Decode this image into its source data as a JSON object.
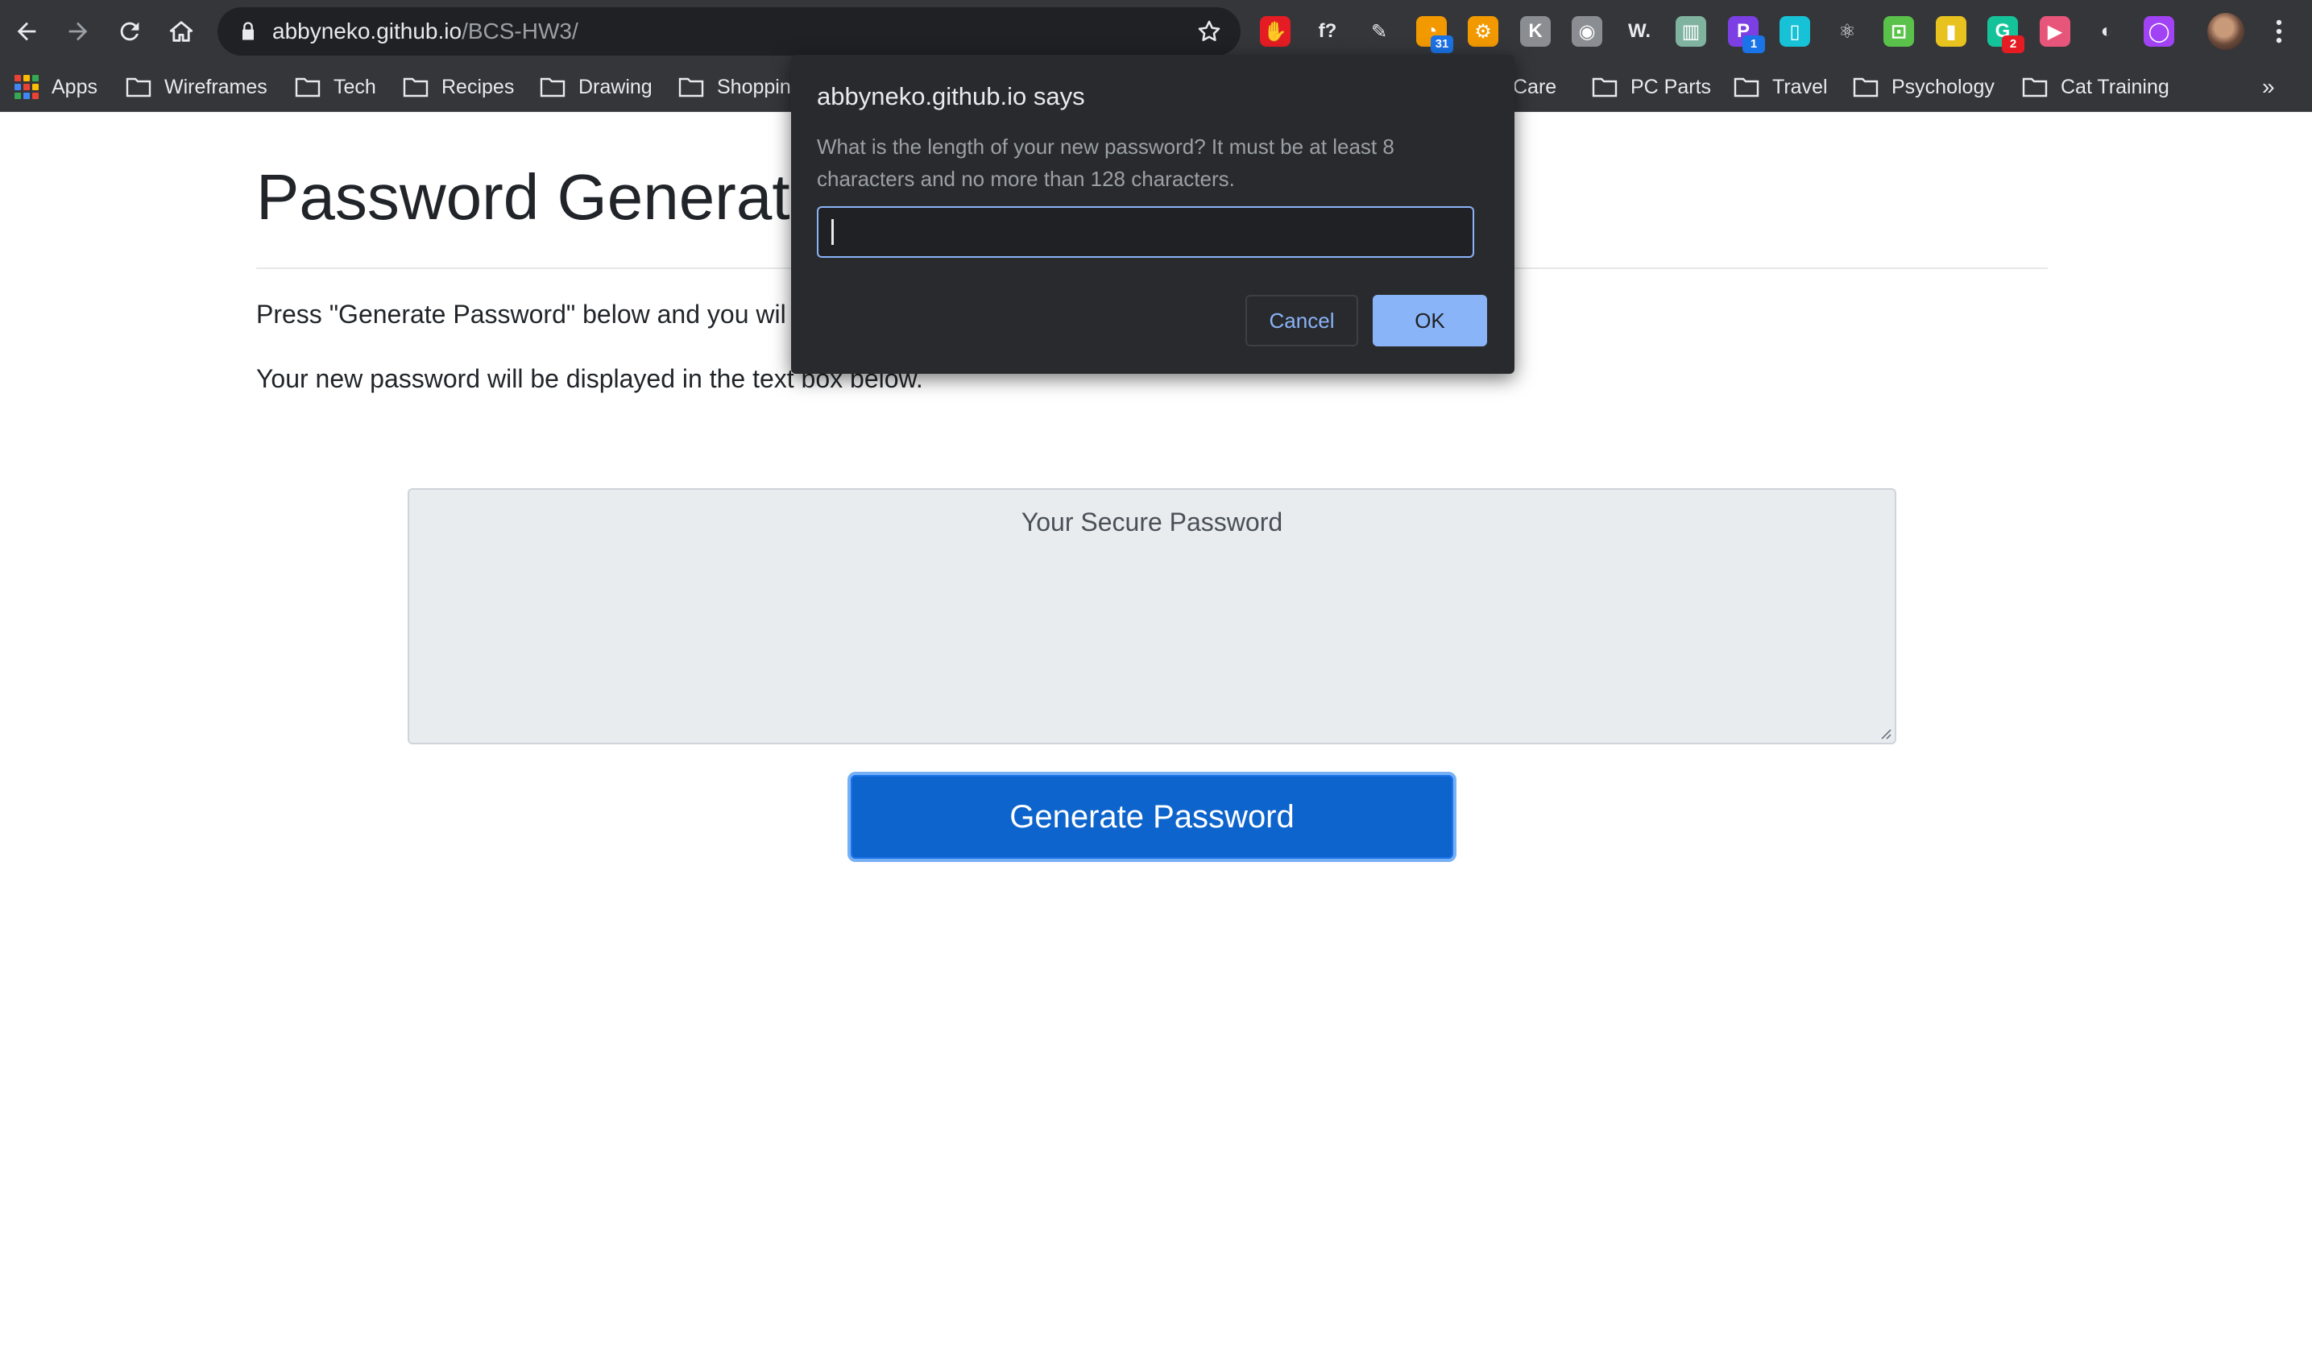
{
  "browser": {
    "url_host": "abbyneko.github.io",
    "url_path": "/BCS-HW3/",
    "extensions": [
      {
        "name": "adblock-icon",
        "color": "#e51c23",
        "glyph": "✋"
      },
      {
        "name": "font-finder-icon",
        "color": "#35363a",
        "glyph": "f?"
      },
      {
        "name": "pen-icon",
        "color": "#35363a",
        "glyph": "✎"
      },
      {
        "name": "rss-icon",
        "color": "#f29900",
        "glyph": "◔",
        "badge": "31",
        "badge_color": "#1a73e8"
      },
      {
        "name": "gear-extension-icon",
        "color": "#f29900",
        "glyph": "⚙"
      },
      {
        "name": "key-extension-icon",
        "color": "#8a8d91",
        "glyph": "K"
      },
      {
        "name": "camera-icon",
        "color": "#8a8d91",
        "glyph": "◉"
      },
      {
        "name": "w-extension-icon",
        "color": "#35363a",
        "glyph": "W."
      },
      {
        "name": "gift-icon",
        "color": "#7fb3a0",
        "glyph": "▥"
      },
      {
        "name": "p-extension-icon",
        "color": "#7b3fe4",
        "glyph": "P",
        "badge": "1",
        "badge_color": "#1a73e8"
      },
      {
        "name": "document-extension-icon",
        "color": "#17c2d6",
        "glyph": "▯"
      },
      {
        "name": "react-icon",
        "color": "#35363a",
        "glyph": "⚛"
      },
      {
        "name": "bookmark-extension-icon",
        "color": "#5ac24a",
        "glyph": "⊡"
      },
      {
        "name": "palette-extension-icon",
        "color": "#e8c21e",
        "glyph": "▮"
      },
      {
        "name": "grammarly-icon",
        "color": "#15c39a",
        "glyph": "G",
        "badge": "2",
        "badge_color": "#e51c23"
      },
      {
        "name": "screen-record-icon",
        "color": "#e8557a",
        "glyph": "▶"
      },
      {
        "name": "circle-extension-icon",
        "color": "#35363a",
        "glyph": "◐"
      },
      {
        "name": "loop-extension-icon",
        "color": "#a142f4",
        "glyph": "◯"
      }
    ],
    "bookmarks": [
      {
        "label": "Apps"
      },
      {
        "label": "Wireframes"
      },
      {
        "label": "Tech"
      },
      {
        "label": "Recipes"
      },
      {
        "label": "Drawing"
      },
      {
        "label": "Shoppin"
      },
      {
        "label": "Care"
      },
      {
        "label": "PC Parts"
      },
      {
        "label": "Travel"
      },
      {
        "label": "Psychology"
      },
      {
        "label": "Cat Training"
      }
    ],
    "more_bookmarks_label": "»"
  },
  "page": {
    "title": "Password Generato",
    "intro_text": "Press \"Generate Password\" below and you wil",
    "display_text": "Your new password will be displayed in the text box below.",
    "password_placeholder": "Your Secure Password",
    "generate_label": "Generate Password"
  },
  "dialog": {
    "title": "abbyneko.github.io says",
    "message": "What is the length of your new password? It must be at least 8 characters and no more than 128 characters.",
    "input_value": "",
    "cancel_label": "Cancel",
    "ok_label": "OK"
  },
  "colors": {
    "chrome": "#35363a",
    "primary_button": "#0d64cc",
    "dialog_bg": "#292a2d",
    "dialog_accent": "#8ab4f8"
  }
}
